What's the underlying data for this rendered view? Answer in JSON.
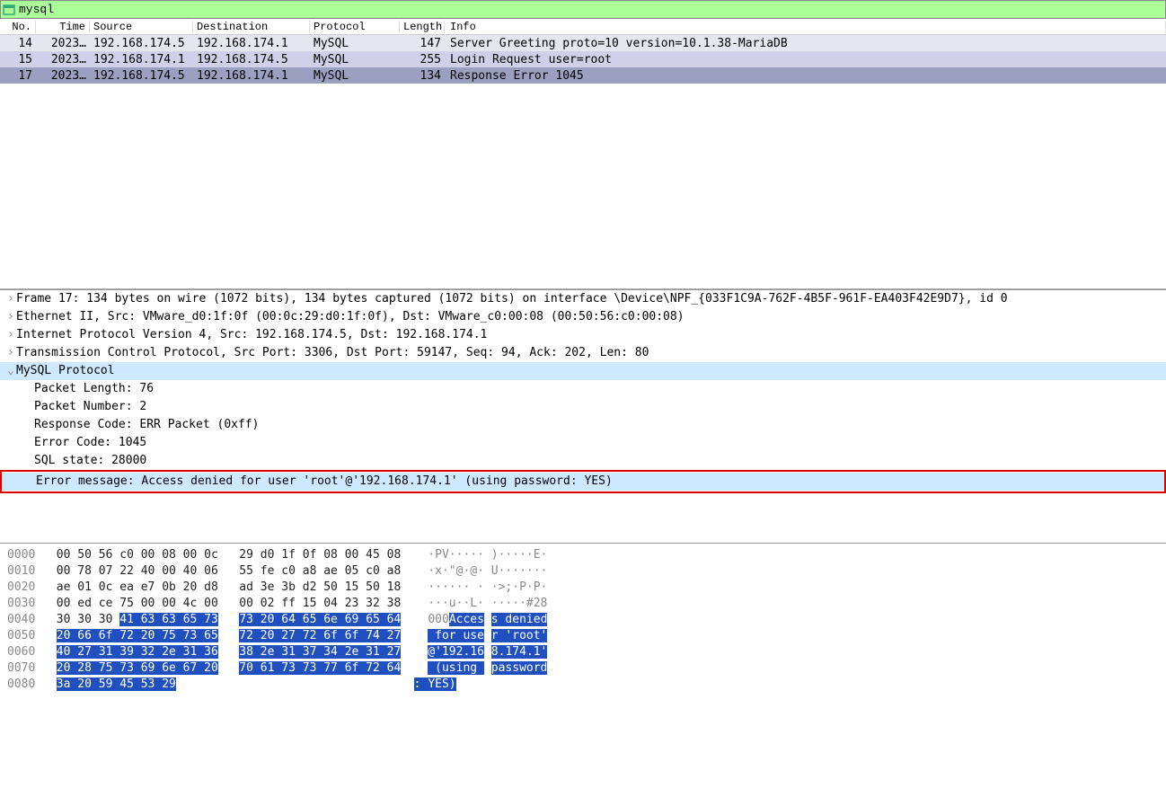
{
  "filter": {
    "value": "mysql"
  },
  "columns": {
    "no": "No.",
    "time": "Time",
    "src": "Source",
    "dst": "Destination",
    "proto": "Protocol",
    "len": "Length",
    "info": "Info"
  },
  "rows": [
    {
      "no": "14",
      "time": "2023…",
      "src": "192.168.174.5",
      "dst": "192.168.174.1",
      "proto": "MySQL",
      "len": "147",
      "info": "Server Greeting proto=10 version=10.1.38-MariaDB",
      "cls": "row-bg1"
    },
    {
      "no": "15",
      "time": "2023…",
      "src": "192.168.174.1",
      "dst": "192.168.174.5",
      "proto": "MySQL",
      "len": "255",
      "info": "Login Request user=root",
      "cls": "row-bg2"
    },
    {
      "no": "17",
      "time": "2023…",
      "src": "192.168.174.5",
      "dst": "192.168.174.1",
      "proto": "MySQL",
      "len": "134",
      "info": "Response Error 1045",
      "cls": "row-sel"
    }
  ],
  "tree": {
    "frame": "Frame 17: 134 bytes on wire (1072 bits), 134 bytes captured (1072 bits) on interface \\Device\\NPF_{033F1C9A-762F-4B5F-961F-EA403F42E9D7}, id 0",
    "eth": "Ethernet II, Src: VMware_d0:1f:0f (00:0c:29:d0:1f:0f), Dst: VMware_c0:00:08 (00:50:56:c0:00:08)",
    "ip": "Internet Protocol Version 4, Src: 192.168.174.5, Dst: 192.168.174.1",
    "tcp": "Transmission Control Protocol, Src Port: 3306, Dst Port: 59147, Seq: 94, Ack: 202, Len: 80",
    "mysql": "MySQL Protocol",
    "plen": "Packet Length: 76",
    "pnum": "Packet Number: 2",
    "resp": "Response Code: ERR Packet (0xff)",
    "ecode": "Error Code: 1045",
    "sqlstate": "SQL state: 28000",
    "emsg": "Error message: Access denied for user 'root'@'192.168.174.1' (using password: YES)"
  },
  "hex": {
    "lines": [
      {
        "off": "0000",
        "h1": "00 50 56 c0 00 08 00 0c",
        "h2": "29 d0 1f 0f 08 00 45 08",
        "a1": "·PV·····",
        "a2": ")·····E·"
      },
      {
        "off": "0010",
        "h1": "00 78 07 22 40 00 40 06",
        "h2": "55 fe c0 a8 ae 05 c0 a8",
        "a1": "·x·\"@·@·",
        "a2": "U·······"
      },
      {
        "off": "0020",
        "h1": "ae 01 0c ea e7 0b 20 d8",
        "h2": "ad 3e 3b d2 50 15 50 18",
        "a1": "······ ·",
        "a2": "·>;·P·P·"
      },
      {
        "off": "0030",
        "h1": "00 ed ce 75 00 00 4c 00",
        "h2": "00 02 ff 15 04 23 32 38",
        "a1": "···u··L·",
        "a2": "·····#28"
      }
    ],
    "l40": {
      "off": "0040",
      "pre": "30 30 30 ",
      "hl": "41 63 63 65 73",
      "hl2": "73 20 64 65 6e 69 65 64",
      "apre": "000",
      "ahl": "Acces",
      "ahl2": "s denied"
    },
    "l50": {
      "off": "0050",
      "hl": "20 66 6f 72 20 75 73 65",
      "hl2": "72 20 27 72 6f 6f 74 27",
      "ahl": " for use",
      "ahl2": "r 'root'"
    },
    "l60": {
      "off": "0060",
      "hl": "40 27 31 39 32 2e 31 36",
      "hl2": "38 2e 31 37 34 2e 31 27",
      "ahl": "@'192.16",
      "ahl2": "8.174.1'"
    },
    "l70": {
      "off": "0070",
      "hl": "20 28 75 73 69 6e 67 20",
      "hl2": "70 61 73 73 77 6f 72 64",
      "ahl": " (using ",
      "ahl2": "password"
    },
    "l80": {
      "off": "0080",
      "hl": "3a 20 59 45 53 29",
      "ahl": ": YES)"
    }
  }
}
